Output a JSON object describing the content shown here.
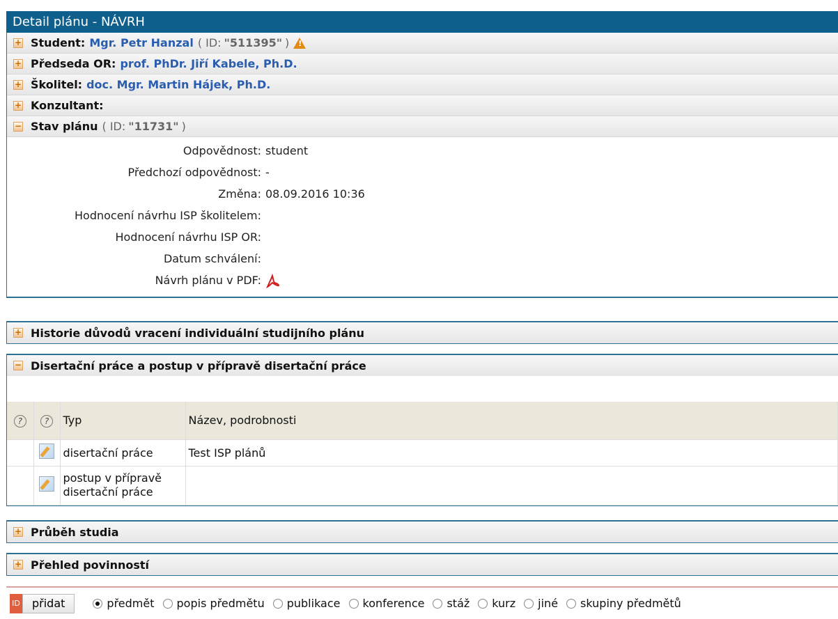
{
  "title": "Detail plánu - NÁVRH",
  "rows": {
    "student": {
      "label": "Student:",
      "name": "Mgr. Petr Hanzal",
      "id_prefix": "( ID:",
      "id_value": "\"511395\"",
      "id_suffix": ")"
    },
    "predseda": {
      "label": "Předseda OR:",
      "name": "prof. PhDr. Jiří Kabele, Ph.D."
    },
    "skolitel": {
      "label": "Školitel:",
      "name": "doc. Mgr. Martin Hájek, Ph.D."
    },
    "konzultant": {
      "label": "Konzultant:"
    },
    "stav": {
      "label": "Stav plánu",
      "id_prefix": "( ID:",
      "id_value": "\"11731\"",
      "id_suffix": ")"
    }
  },
  "stav_fields": [
    {
      "label": "Odpovědnost:",
      "value": "student"
    },
    {
      "label": "Předchozí odpovědnost:",
      "value": "-"
    },
    {
      "label": "Změna:",
      "value": "08.09.2016 10:36"
    },
    {
      "label": "Hodnocení návrhu ISP školitelem:",
      "value": ""
    },
    {
      "label": "Hodnocení návrhu ISP OR:",
      "value": ""
    },
    {
      "label": "Datum schválení:",
      "value": ""
    },
    {
      "label": "Návrh plánu v PDF:",
      "value": ""
    }
  ],
  "historie": "Historie důvodů vracení individuální studijního plánu",
  "disertace": {
    "heading": "Disertační práce a postup v přípravě disertační práce",
    "columns": [
      "Typ",
      "Název, podrobnosti"
    ],
    "rows": [
      {
        "typ": "disertační práce",
        "nazev": "Test ISP plánů"
      },
      {
        "typ": "postup v přípravě disertační práce",
        "nazev": ""
      }
    ]
  },
  "prubeh": "Průběh studia",
  "prehled": "Přehled povinností",
  "bottom": {
    "badge": "ID",
    "add_label": "přidat",
    "options": [
      "předmět",
      "popis předmětu",
      "publikace",
      "konference",
      "stáž",
      "kurz",
      "jiné",
      "skupiny předmětů"
    ],
    "selected": "předmět"
  },
  "colors": {
    "header": "#0f5f8c",
    "link": "#2a5db0",
    "accent": "#e08a10"
  }
}
